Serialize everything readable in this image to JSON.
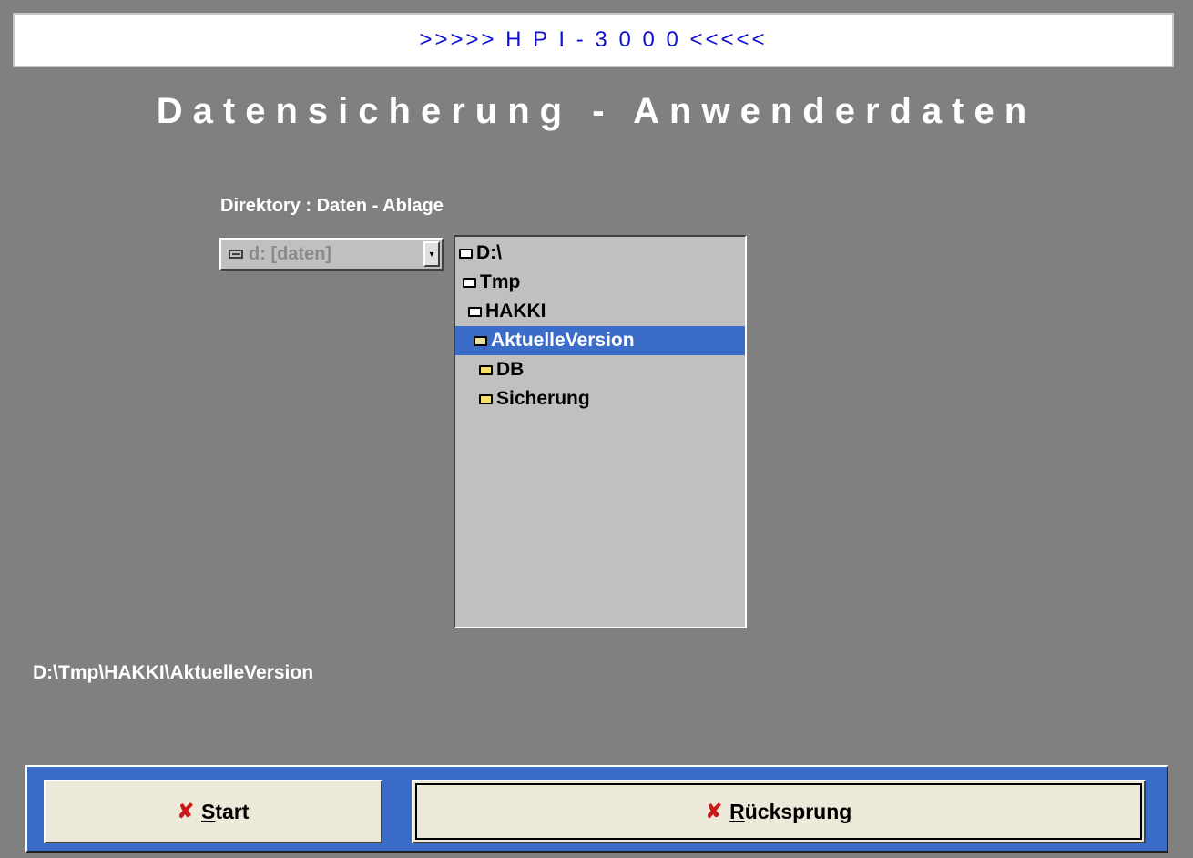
{
  "banner": ">>>>> H P I - 3 0 0 0 <<<<<",
  "heading": "Datensicherung - Anwenderdaten",
  "directory_label": "Direktory : Daten - Ablage",
  "drive": {
    "icon": "drive-icon",
    "value": "d: [daten]",
    "dropdown_arrow": "▾"
  },
  "tree": [
    {
      "label": "D:\\",
      "level": 0,
      "open": true
    },
    {
      "label": "Tmp",
      "level": 0,
      "open": true
    },
    {
      "label": "HAKKI",
      "level": 1,
      "open": true
    },
    {
      "label": "AktuelleVersion",
      "level": 1,
      "open": true,
      "selected": true
    },
    {
      "label": "DB",
      "level": 2,
      "open": false
    },
    {
      "label": "Sicherung",
      "level": 2,
      "open": false
    }
  ],
  "current_path": "D:\\Tmp\\HAKKI\\AktuelleVersion",
  "buttons": {
    "start": {
      "accel": "S",
      "rest": "tart",
      "icon": "x-icon"
    },
    "back": {
      "accel": "R",
      "rest": "ücksprung",
      "icon": "x-icon"
    }
  },
  "colors": {
    "background": "#808080",
    "selection": "#3a6cc8",
    "banner_text": "#1010d0",
    "x_icon": "#c81818"
  }
}
